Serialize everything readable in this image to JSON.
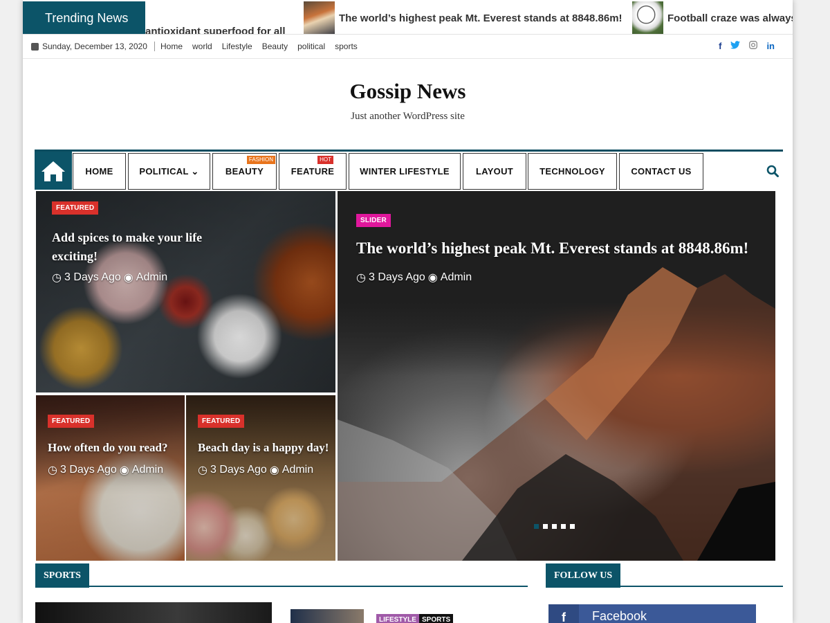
{
  "ticker": {
    "label": "Trending News",
    "items": [
      {
        "text": "antioxidant superfood for all",
        "thumb": "none"
      },
      {
        "text": "The world’s highest peak Mt. Everest stands at 8848.86m!",
        "thumb": "mountain"
      },
      {
        "text": "Football craze was always",
        "thumb": "football"
      }
    ]
  },
  "topbar": {
    "date": "Sunday, December 13, 2020",
    "links": [
      "Home",
      "world",
      "Lifestyle",
      "Beauty",
      "political",
      "sports"
    ],
    "socials": [
      {
        "icon": "facebook-icon",
        "glyph": "f",
        "color": "#1a3d8f"
      },
      {
        "icon": "twitter-icon",
        "glyph": "t",
        "color": "#1da1f2"
      },
      {
        "icon": "instagram-icon",
        "glyph": "◎",
        "color": "#888888"
      },
      {
        "icon": "linkedin-icon",
        "glyph": "in",
        "color": "#0a66c2"
      }
    ]
  },
  "site": {
    "title": "Gossip News",
    "description": "Just another WordPress site"
  },
  "nav": {
    "items": [
      {
        "label": "HOME"
      },
      {
        "label": "POLITICAL ⌄"
      },
      {
        "label": "BEAUTY",
        "tag": "FASHION",
        "tag_color": "#e8741c"
      },
      {
        "label": "FEATURE",
        "tag": "HOT",
        "tag_color": "#d9312b"
      },
      {
        "label": "WINTER LIFESTYLE"
      },
      {
        "label": "LAYOUT"
      },
      {
        "label": "TECHNOLOGY"
      },
      {
        "label": "CONTACT US"
      }
    ]
  },
  "featured": {
    "main": {
      "badge": "FEATURED",
      "title": "Add spices to make your life exciting!",
      "time": "3 Days Ago",
      "author": "Admin"
    },
    "small_1": {
      "badge": "FEATURED",
      "title": "How often do you read?",
      "time": "3 Days Ago",
      "author": "Admin"
    },
    "small_2": {
      "badge": "FEATURED",
      "title": "Beach day is a happy day!",
      "time": "3 Days Ago",
      "author": "Admin"
    },
    "slider": {
      "badge": "SLIDER",
      "title": "The world’s highest peak Mt. Everest stands at 8848.86m!",
      "time": "3 Days Ago",
      "author": "Admin",
      "slide_count": 5,
      "active_slide": 1
    }
  },
  "sections": {
    "sports": "SPORTS",
    "follow": "FOLLOW US",
    "facebook": "Facebook",
    "tags": [
      "LIFESTYLE",
      "SPORTS"
    ]
  },
  "colors": {
    "accent": "#0c5468",
    "badge_red": "#d9312b",
    "badge_pink": "#e0179c",
    "facebook": "#3b5998"
  }
}
